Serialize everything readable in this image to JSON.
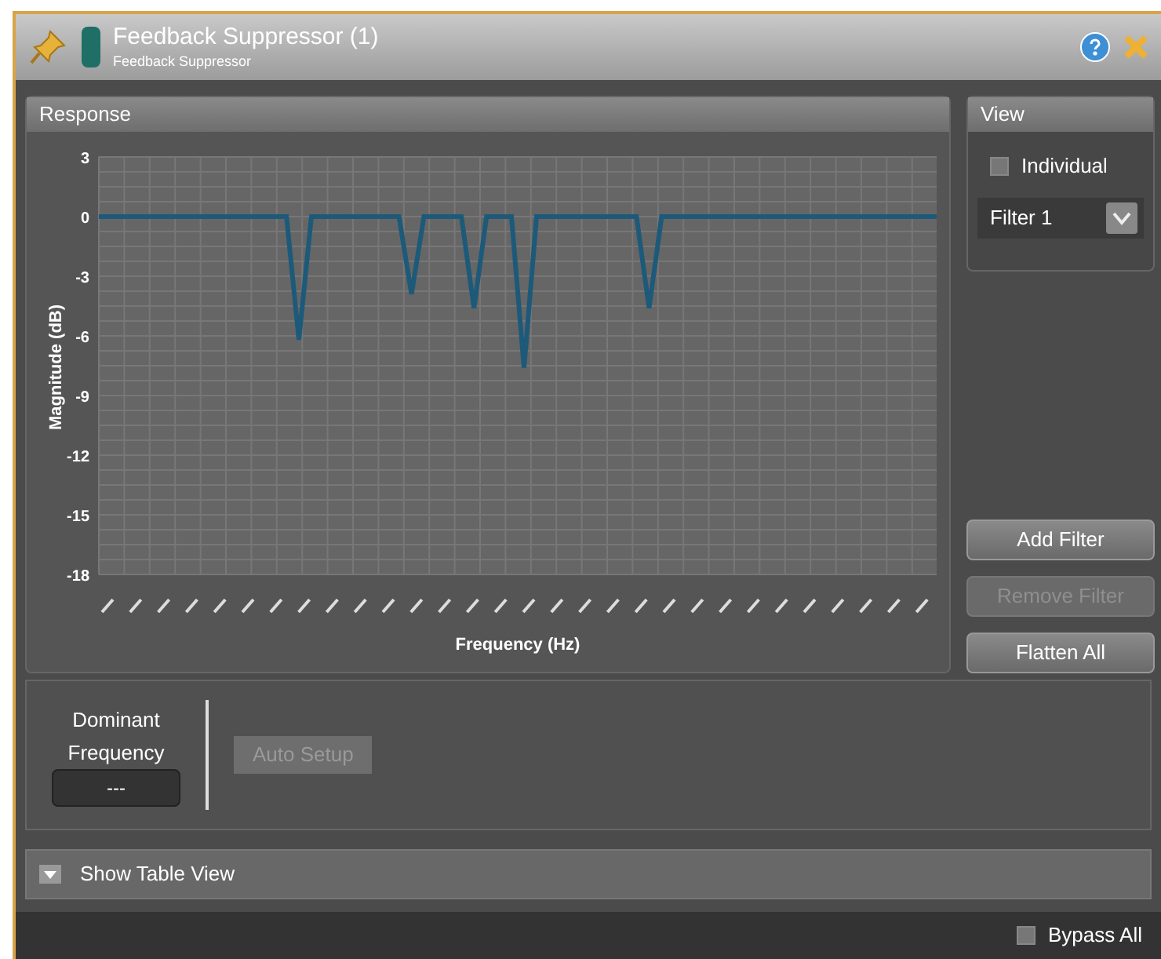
{
  "window": {
    "title": "Feedback Suppressor (1)",
    "subtitle": "Feedback Suppressor"
  },
  "response": {
    "title": "Response",
    "chart_data": {
      "type": "line",
      "grid": true,
      "xlabel": "Frequency (Hz)",
      "ylabel": "Magnitude (dB)",
      "ylim": [
        -18,
        3
      ],
      "yticks": [
        3,
        0,
        -3,
        -6,
        -9,
        -12,
        -15,
        -18
      ],
      "series": [
        {
          "color": "#1d5a7a",
          "values": [
            0,
            0,
            0,
            0,
            0,
            0,
            0,
            0,
            0,
            0,
            0,
            0,
            0,
            0,
            0,
            0,
            -6.2,
            0,
            0,
            0,
            0,
            0,
            0,
            0,
            0,
            -3.9,
            0,
            0,
            0,
            0,
            -4.6,
            0,
            0,
            0,
            -7.6,
            0,
            0,
            0,
            0,
            0,
            0,
            0,
            0,
            0,
            -4.6,
            0,
            0,
            0,
            0,
            0,
            0,
            0,
            0,
            0,
            0,
            0,
            0,
            0,
            0,
            0,
            0,
            0,
            0,
            0,
            0,
            0,
            0,
            0
          ]
        }
      ]
    }
  },
  "view": {
    "title": "View",
    "individual": {
      "label": "Individual",
      "checked": false
    },
    "filter_select": {
      "value": "Filter 1"
    }
  },
  "buttons": [
    {
      "label": "Add Filter",
      "disabled": false
    },
    {
      "label": "Remove Filter",
      "disabled": true
    },
    {
      "label": "Flatten All",
      "disabled": false
    }
  ],
  "dominant_frequency": {
    "label": "Dominant Frequency",
    "value": "---"
  },
  "auto_setup": {
    "label": "Auto Setup",
    "disabled": true
  },
  "table_view": {
    "label": "Show Table View",
    "expanded": false
  },
  "bypass_all": {
    "label": "Bypass All",
    "checked": false
  }
}
